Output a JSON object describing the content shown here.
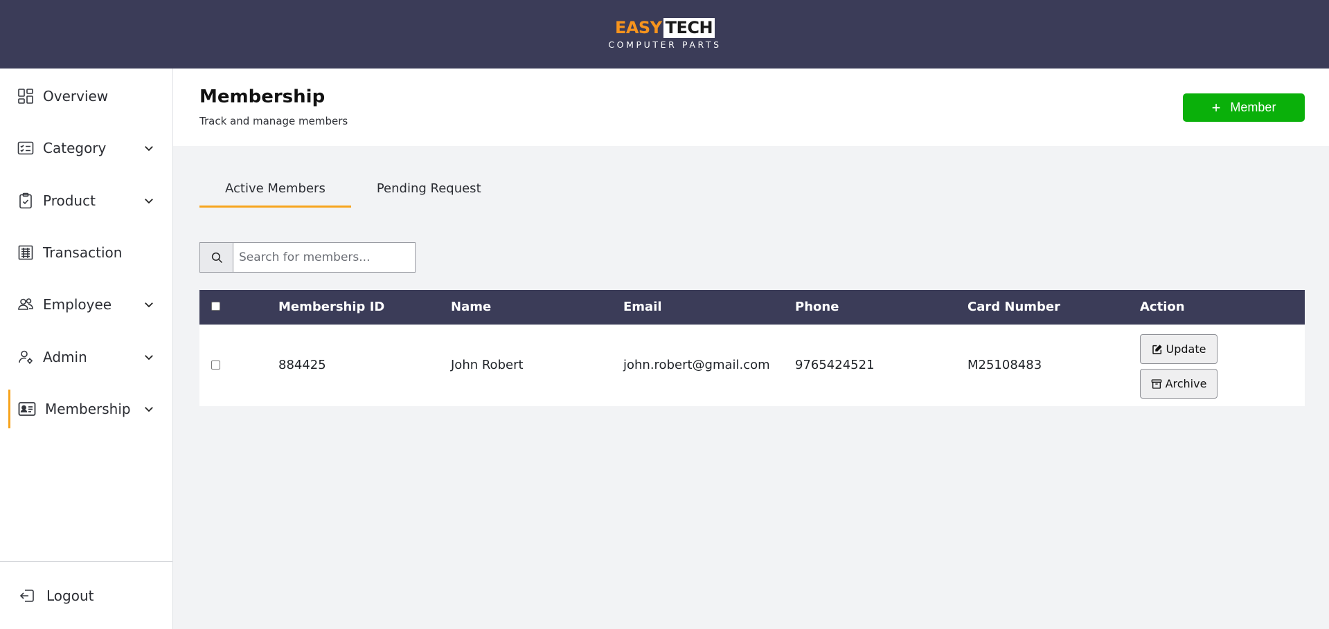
{
  "header": {
    "logo_word_1": "EASY",
    "logo_word_2": "TECH",
    "logo_tagline": "COMPUTER PARTS",
    "brand_colors": {
      "bar": "#3b3c58",
      "accent": "#f7941d"
    }
  },
  "sidebar": {
    "items": [
      {
        "label": "Overview",
        "icon": "grid-icon",
        "expandable": false
      },
      {
        "label": "Category",
        "icon": "list-icon",
        "expandable": true
      },
      {
        "label": "Product",
        "icon": "clipboard-check-icon",
        "expandable": true
      },
      {
        "label": "Transaction",
        "icon": "receipt-icon",
        "expandable": false
      },
      {
        "label": "Employee",
        "icon": "users-icon",
        "expandable": true
      },
      {
        "label": "Admin",
        "icon": "user-gear-icon",
        "expandable": true
      },
      {
        "label": "Membership",
        "icon": "id-card-icon",
        "expandable": true,
        "active": true
      }
    ],
    "logout_label": "Logout"
  },
  "page": {
    "title": "Membership",
    "subtitle": "Track and manage members",
    "add_button_label": "Member"
  },
  "tabs": [
    {
      "label": "Active Members",
      "active": true
    },
    {
      "label": "Pending Request",
      "active": false
    }
  ],
  "search": {
    "placeholder": "Search for members...",
    "value": ""
  },
  "table": {
    "columns": [
      "Membership ID",
      "Name",
      "Email",
      "Phone",
      "Card Number",
      "Action"
    ],
    "rows": [
      {
        "membership_id": "884425",
        "name": "John Robert",
        "email": "john.robert@gmail.com",
        "phone": "9765424521",
        "card_number": "M25108483",
        "actions": {
          "update": "Update",
          "archive": "Archive"
        }
      }
    ]
  },
  "colors": {
    "accent": "#f7a41d",
    "primary_green": "#0ab00a",
    "table_header": "#3b3c58",
    "page_bg": "#f2f3f5"
  }
}
